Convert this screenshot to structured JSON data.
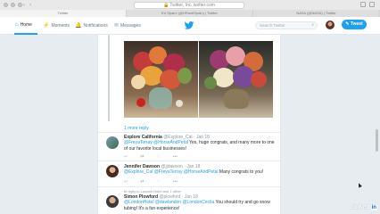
{
  "browser": {
    "url": "Twitter, Inc. twitter.com",
    "tabs": [
      "Twitter",
      "It's Spain! (@HRueflSpain) | Twitter",
      "NASA (@NASA) | Twitter"
    ]
  },
  "nav": {
    "items": [
      {
        "label": "Home",
        "icon": "home-icon"
      },
      {
        "label": "Moments",
        "icon": "lightning-icon"
      },
      {
        "label": "Notifications",
        "icon": "bell-icon"
      },
      {
        "label": "Messages",
        "icon": "envelope-icon"
      }
    ],
    "search_placeholder": "Search Twitter",
    "tweet_button": "Tweet"
  },
  "colors": {
    "accent": "#1da1f2",
    "text": "#292f33",
    "muted": "#8899a6"
  },
  "thread": {
    "more_reply": "1 more reply",
    "tweets": [
      {
        "name": "Explore California",
        "handle": "@Explore_Cal · Jan 18",
        "text_pre": "",
        "mentions": "@FreyaTerray @HorseAndPetal",
        "text_post": " Yes, huge congrats, and many more to one of our favorite local businesses!"
      },
      {
        "name": "Jennifer Dawson",
        "handle": "@jjdawson · Jan 18",
        "mentions": "@Explore_Cal @FreyaTerray @HorseAndPetal",
        "text_post": " Many congrats to you!"
      },
      {
        "context": "In reply to London Hotel and 1 other",
        "name": "Simon Plowford",
        "handle": "@plowford · Jan 18",
        "mentions": "@LondonHotel @dawlandon @LondonCecila",
        "text_post": " You should try and go snow tubing! It's a fun experience!"
      }
    ]
  },
  "watermark": {
    "text": "Linked",
    "badge": "in"
  }
}
